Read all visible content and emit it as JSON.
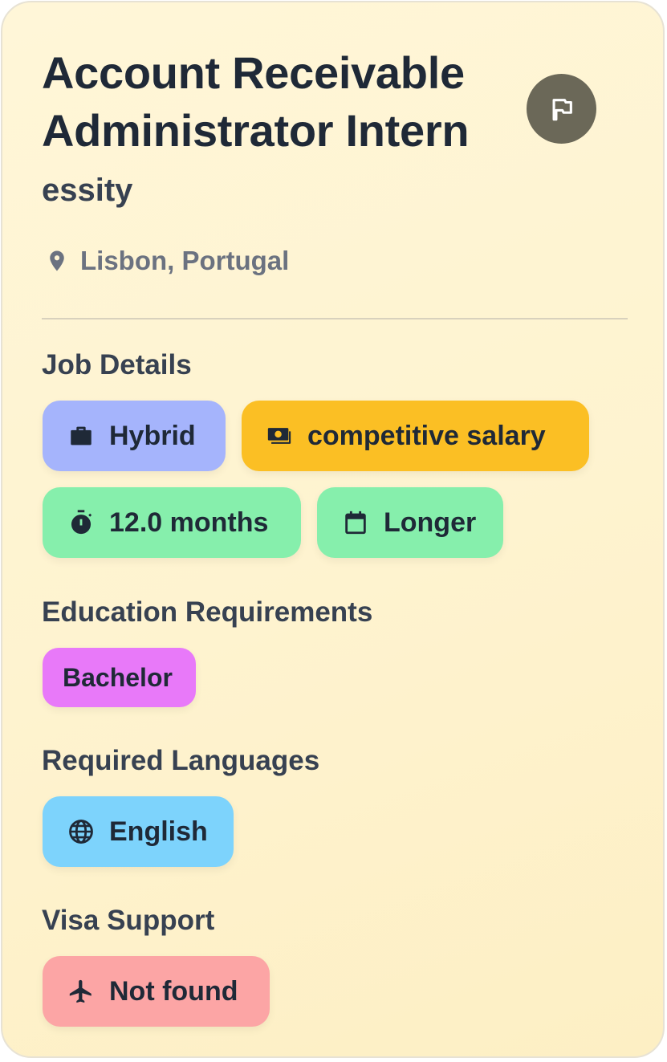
{
  "job": {
    "title": "Account Receivable Administrator Intern",
    "company": "essity",
    "location": "Lisbon, Portugal"
  },
  "sections": {
    "job_details": "Job Details",
    "education": "Education Requirements",
    "languages": "Required Languages",
    "visa": "Visa Support"
  },
  "tags": {
    "work_mode": "Hybrid",
    "salary": "competitive salary",
    "duration": "12.0 months",
    "period": "Longer",
    "education": "Bachelor",
    "language": "English",
    "visa": "Not found"
  },
  "icons": {
    "flag": "flag-icon",
    "location": "map-pin-icon",
    "work_mode": "briefcase-icon",
    "salary": "money-icon",
    "duration": "stopwatch-icon",
    "period": "calendar-icon",
    "language": "globe-icon",
    "visa": "airplane-icon"
  },
  "colors": {
    "card_bg": "#fef3cf",
    "work_mode_tag": "#a5b4fc",
    "salary_tag": "#fbbf24",
    "duration_tag": "#86efac",
    "education_tag": "#e879f9",
    "language_tag": "#7dd3fc",
    "visa_tag": "#fca5a5",
    "flag_button": "#6b6858"
  }
}
